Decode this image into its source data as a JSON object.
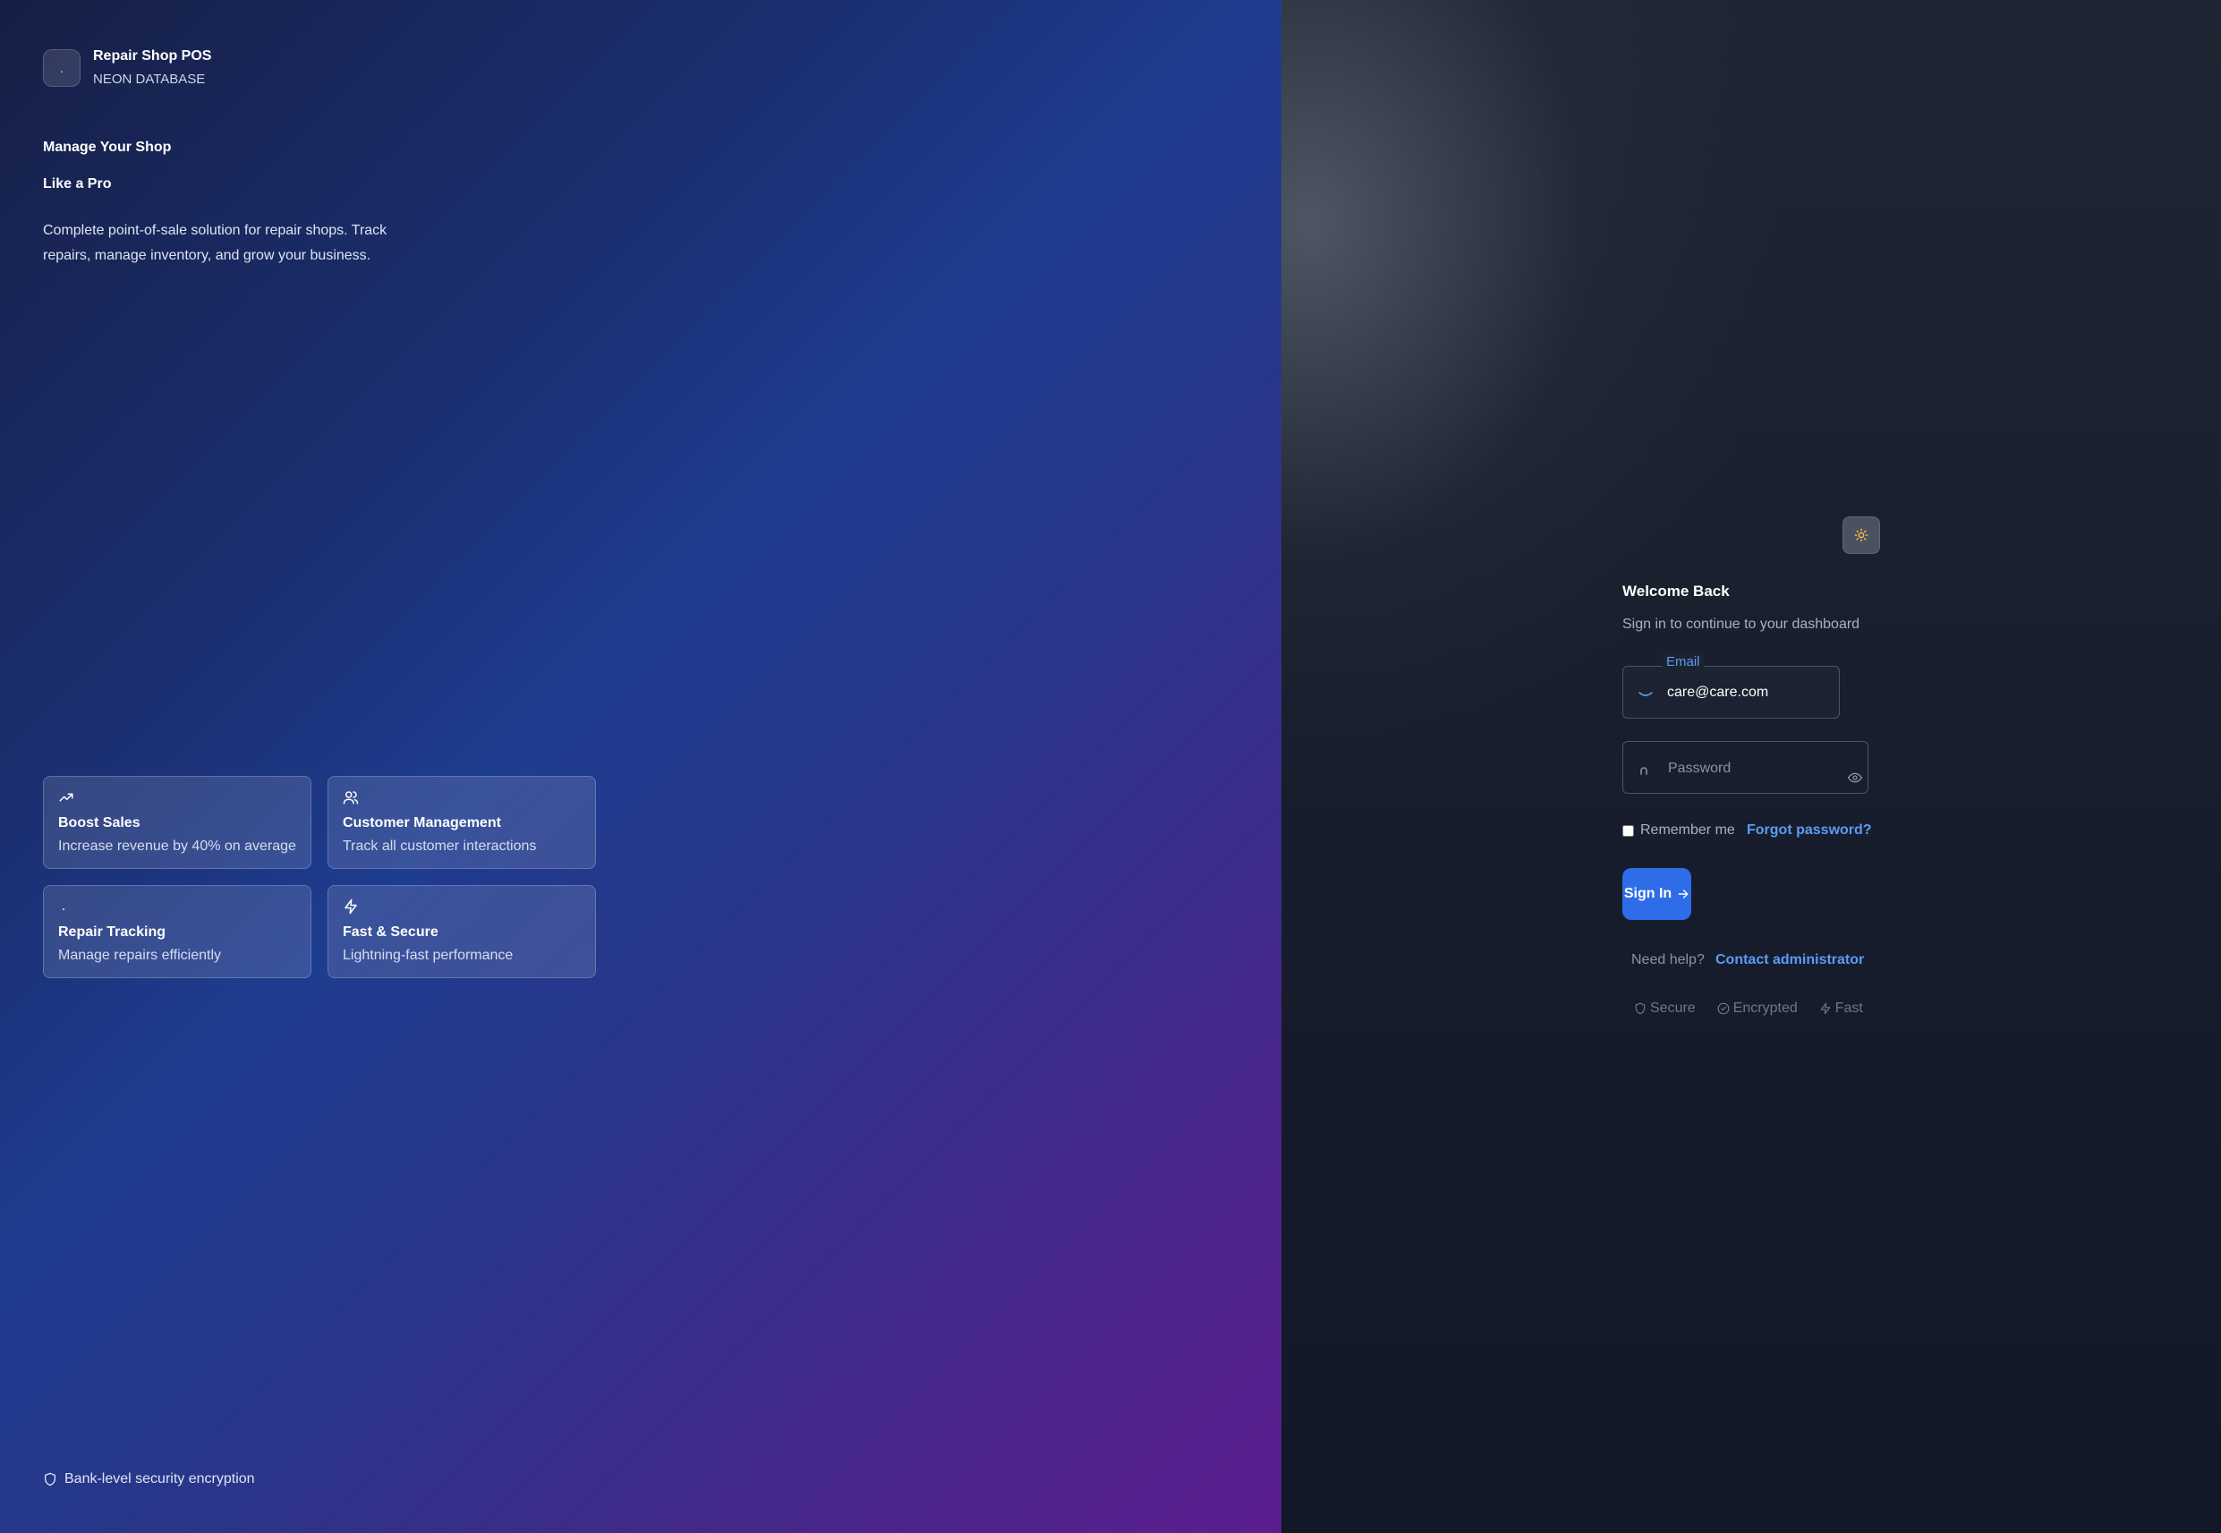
{
  "brand": {
    "logo_glyph": ".",
    "title": "Repair Shop POS",
    "subtitle": "NEON DATABASE"
  },
  "hero": {
    "line1": "Manage Your Shop",
    "line2": "Like a Pro",
    "description": "Complete point-of-sale solution for repair shops. Track repairs, manage inventory, and grow your business."
  },
  "features": [
    {
      "icon": "trending-up-icon",
      "title": "Boost Sales",
      "desc": "Increase revenue by 40% on average"
    },
    {
      "icon": "users-icon",
      "title": "Customer Management",
      "desc": "Track all customer interactions"
    },
    {
      "icon": "wrench-icon",
      "title": "Repair Tracking",
      "desc": "Manage repairs efficiently"
    },
    {
      "icon": "zap-icon",
      "title": "Fast & Secure",
      "desc": "Lightning-fast performance"
    }
  ],
  "footer": {
    "security_text": "Bank-level security encryption"
  },
  "login": {
    "title": "Welcome Back",
    "subtitle": "Sign in to continue to your dashboard",
    "email_label": "Email",
    "email_value": "care@care.com",
    "password_placeholder": "Password",
    "remember_label": "Remember me",
    "forgot_label": "Forgot password?",
    "signin_label": "Sign In",
    "help_text": "Need help?",
    "contact_label": "Contact administrator",
    "badges": [
      "Secure",
      "Encrypted",
      "Fast"
    ]
  },
  "colors": {
    "accent": "#2f6de8",
    "link": "#5b9bf5",
    "sun": "#f5c242"
  }
}
